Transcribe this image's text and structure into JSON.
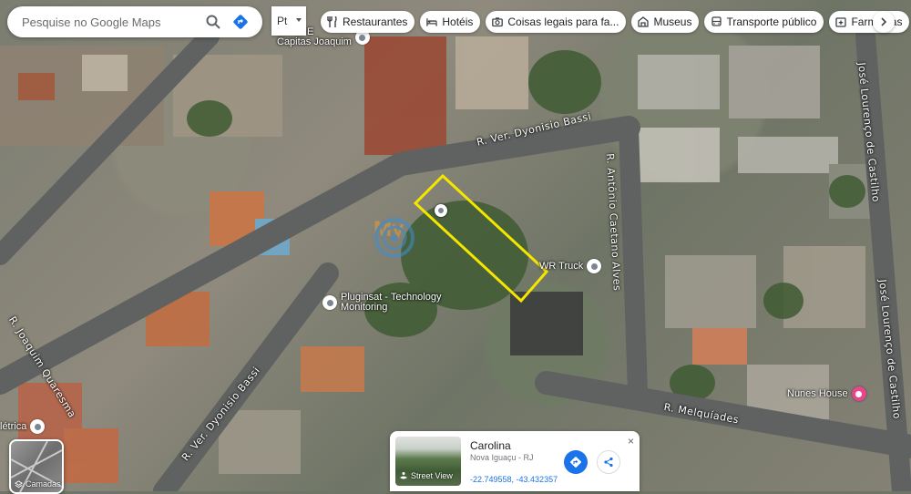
{
  "search": {
    "placeholder": "Pesquise no Google Maps"
  },
  "language": {
    "label": "Pt"
  },
  "chips": [
    {
      "label": "Restaurantes",
      "icon": "fork-knife-icon"
    },
    {
      "label": "Hotéis",
      "icon": "bed-icon"
    },
    {
      "label": "Coisas legais para fa...",
      "icon": "camera-icon"
    },
    {
      "label": "Museus",
      "icon": "museum-icon"
    },
    {
      "label": "Transporte público",
      "icon": "bus-icon"
    },
    {
      "label": "Farmácias",
      "icon": "pharmacy-icon"
    }
  ],
  "streets": {
    "dyonisio_top": "R. Ver. Dyonisio Bassi",
    "dyonisio_bottom": "R. Ver. Dyonisio Bassi",
    "antonio": "R. Antônio Caetano Alves",
    "joaquim": "R. Joaquim Quaresma",
    "melquiades": "R. Melquíades",
    "jose_upper": "José Lourenço de Castilho",
    "jose_lower": "José Lourenço de Castilho"
  },
  "places": {
    "capitas": [
      "Jornal E",
      "Capitas Joaquim"
    ],
    "wr_truck": "WR Truck",
    "pluginsat": [
      "Pluginsat - Technology",
      "Monitoring"
    ],
    "nunes": "Nunes House",
    "eletrica": "létrica"
  },
  "watermark": {
    "text": "My"
  },
  "layers": {
    "label": "Camadas"
  },
  "place_card": {
    "title": "Carolina",
    "subtitle": "Nova Iguaçu - RJ",
    "coords": "-22.749558, -43.432357",
    "street_view": "Street View",
    "close": "×"
  },
  "colors": {
    "highlight": "#f5e600",
    "accent": "#1a73e8",
    "pink_pin": "#e8468c"
  }
}
